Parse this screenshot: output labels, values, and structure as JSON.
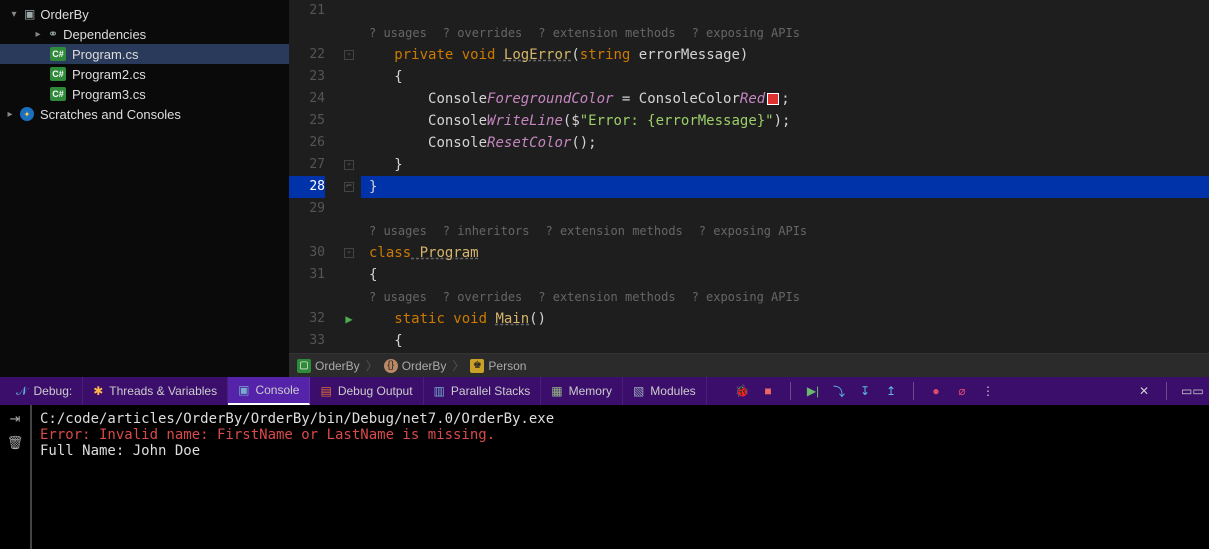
{
  "sidebar": {
    "project": "OrderBy",
    "dependencies": "Dependencies",
    "files": [
      "Program.cs",
      "Program2.cs",
      "Program3.cs"
    ],
    "scratches": "Scratches and Consoles"
  },
  "editor": {
    "lineNumbers": [
      "21",
      "22",
      "23",
      "24",
      "25",
      "26",
      "27",
      "28",
      "29",
      "30",
      "31",
      "32",
      "33"
    ],
    "activeLine": "28",
    "hints1": {
      "a": "? usages",
      "b": "? overrides",
      "c": "? extension methods",
      "d": "? exposing APIs"
    },
    "hints2": {
      "a": "? usages",
      "b": "? inheritors",
      "c": "? extension methods",
      "d": "? exposing APIs"
    },
    "hints3": {
      "a": "? usages",
      "b": "? overrides",
      "c": "? extension methods",
      "d": "? exposing APIs"
    },
    "code": {
      "l22": {
        "kw1": "private",
        "kw2": "void",
        "name": "LogError",
        "p1": "(",
        "kw3": "string",
        "arg": " errorMessage)",
        "close": ""
      },
      "l23": "{",
      "l24": {
        "a": "Console",
        ".1": ".",
        "b": "ForegroundColor",
        "eq": " = ",
        "c": "ConsoleColor",
        ".2": ".",
        "d": "Red",
        "sc": ";"
      },
      "l25": {
        "a": "Console",
        ".1": ".",
        "b": "WriteLine",
        "p": "($",
        "s": "\"Error: {errorMessage}\"",
        "c": ");"
      },
      "l26": {
        "a": "Console",
        ".1": ".",
        "b": "ResetColor",
        "p": "();"
      },
      "l27": "}",
      "l28": "}",
      "l30": {
        "kw": "class",
        "name": " Program"
      },
      "l31": "{",
      "l32": {
        "kw1": "static",
        "kw2": " void ",
        "name": "Main",
        "p": "()"
      },
      "l33": "{"
    }
  },
  "breadcrumbs": {
    "a": "OrderBy",
    "b": "OrderBy",
    "c": "Person"
  },
  "debugBar": {
    "label": "Debug:",
    "tabs": {
      "threads": "Threads & Variables",
      "console": "Console",
      "debugOutput": "Debug Output",
      "parallel": "Parallel Stacks",
      "memory": "Memory",
      "modules": "Modules"
    }
  },
  "console": {
    "path": "C:/code/articles/OrderBy/OrderBy/bin/Debug/net7.0/OrderBy.exe",
    "error": "Error: Invalid name: FirstName or LastName is missing.",
    "out": "Full Name: John Doe"
  },
  "icons": {
    "cs": "C#"
  }
}
